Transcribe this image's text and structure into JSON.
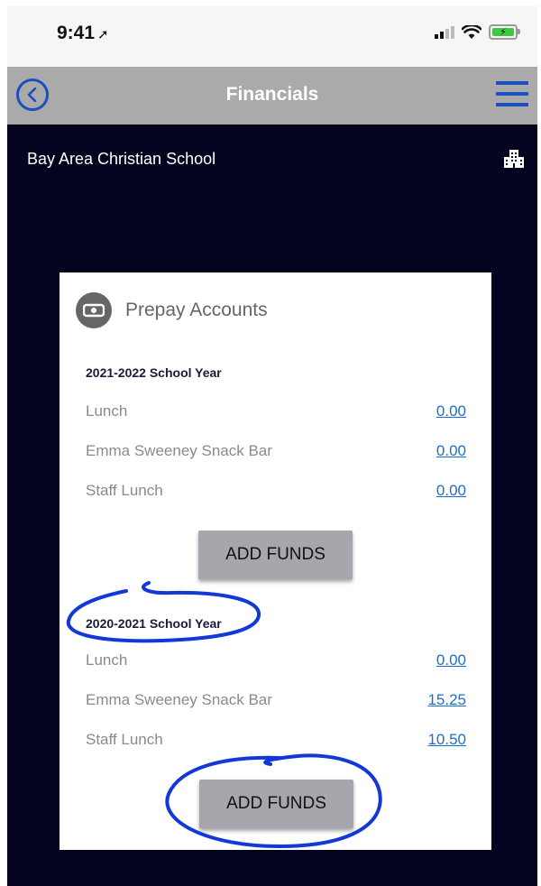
{
  "status_bar": {
    "time": "9:41",
    "location_glyph": "➚"
  },
  "header": {
    "title": "Financials"
  },
  "school": {
    "name": "Bay Area Christian School"
  },
  "card": {
    "title": "Prepay Accounts",
    "sections": [
      {
        "year": "2021-2022 School Year",
        "rows": [
          {
            "label": "Lunch",
            "amount": "0.00"
          },
          {
            "label": "Emma Sweeney Snack Bar",
            "amount": "0.00"
          },
          {
            "label": "Staff Lunch",
            "amount": "0.00"
          }
        ],
        "button": "ADD FUNDS"
      },
      {
        "year": "2020-2021 School Year",
        "rows": [
          {
            "label": "Lunch",
            "amount": "0.00"
          },
          {
            "label": "Emma Sweeney Snack Bar",
            "amount": "15.25"
          },
          {
            "label": "Staff Lunch",
            "amount": "10.50"
          }
        ],
        "button": "ADD FUNDS"
      }
    ]
  },
  "colors": {
    "accent": "#1a4fbf",
    "annotation": "#1238d8",
    "background": "#03031f",
    "link": "#1a6fd1"
  }
}
